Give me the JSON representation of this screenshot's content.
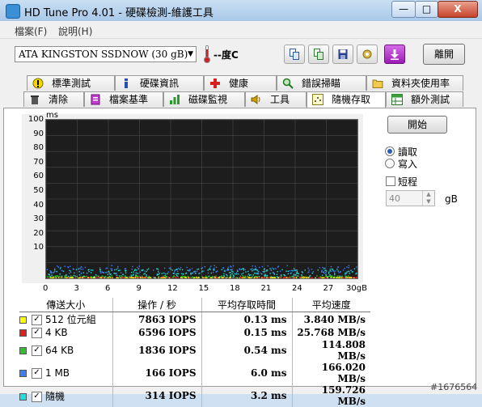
{
  "window": {
    "title": "HD Tune Pro 4.01 - 硬碟檢測-維護工具",
    "minimize": "—",
    "maximize": "□",
    "close": "X"
  },
  "menu": [
    "檔案(F)",
    "說明(H)"
  ],
  "toolbar": {
    "drive": "ATA   KINGSTON SSDNOW  (30 gB)",
    "temperature": "--度C",
    "exit_label": "離開"
  },
  "tabs_row1": [
    "標準測試",
    "硬碟資訊",
    "健康",
    "錯誤掃瞄",
    "資料夾使用率"
  ],
  "tabs_row2": [
    "清除",
    "檔案基準",
    "磁碟監視",
    "工具",
    "隨機存取",
    "額外測試"
  ],
  "active_tab": "隨機存取",
  "chart_data": {
    "type": "scatter",
    "ylabel": "ms",
    "xunit": "gB",
    "ylim": [
      0,
      100
    ],
    "xlim": [
      0,
      30
    ],
    "y_ticks": [
      "100",
      "90",
      "80",
      "70",
      "60",
      "50",
      "40",
      "30",
      "20",
      "10"
    ],
    "x_ticks": [
      "0",
      "3",
      "6",
      "9",
      "12",
      "15",
      "18",
      "21",
      "24",
      "27",
      "30gB"
    ],
    "grid": true,
    "series": [
      {
        "name": "512 位元組",
        "color": "#ffff00",
        "band": [
          0.05,
          0.4
        ]
      },
      {
        "name": "4 KB",
        "color": "#ff2020",
        "band": [
          0.05,
          0.6
        ]
      },
      {
        "name": "64 KB",
        "color": "#20d020",
        "band": [
          0.3,
          1.5
        ]
      },
      {
        "name": "1 MB",
        "color": "#3c7dff",
        "band": [
          3,
          8
        ]
      },
      {
        "name": "隨機",
        "color": "#22dede",
        "band": [
          0.3,
          6
        ]
      }
    ]
  },
  "controls": {
    "start_label": "開始",
    "read_label": "讀取",
    "write_label": "寫入",
    "short_label": "短程",
    "short_value": "40",
    "short_unit": "gB"
  },
  "results": {
    "headers": [
      "傳送大小",
      "操作 / 秒",
      "平均存取時間",
      "平均速度"
    ],
    "rows": [
      {
        "color": "#ffff00",
        "size": "512 位元組",
        "iops": "7863 IOPS",
        "time": "0.13 ms",
        "speed": "3.840 MB/s"
      },
      {
        "color": "#e02020",
        "size": "4 KB",
        "iops": "6596 IOPS",
        "time": "0.15 ms",
        "speed": "25.768 MB/s"
      },
      {
        "color": "#30c030",
        "size": "64 KB",
        "iops": "1836 IOPS",
        "time": "0.54 ms",
        "speed": "114.808 MB/s"
      },
      {
        "color": "#3c7dff",
        "size": "1 MB",
        "iops": "166 IOPS",
        "time": "6.0 ms",
        "speed": "166.020 MB/s"
      },
      {
        "color": "#22dede",
        "size": "隨機",
        "iops": "314 IOPS",
        "time": "3.2 ms",
        "speed": "159.726 MB/s"
      }
    ]
  },
  "watermark": "#1676564"
}
